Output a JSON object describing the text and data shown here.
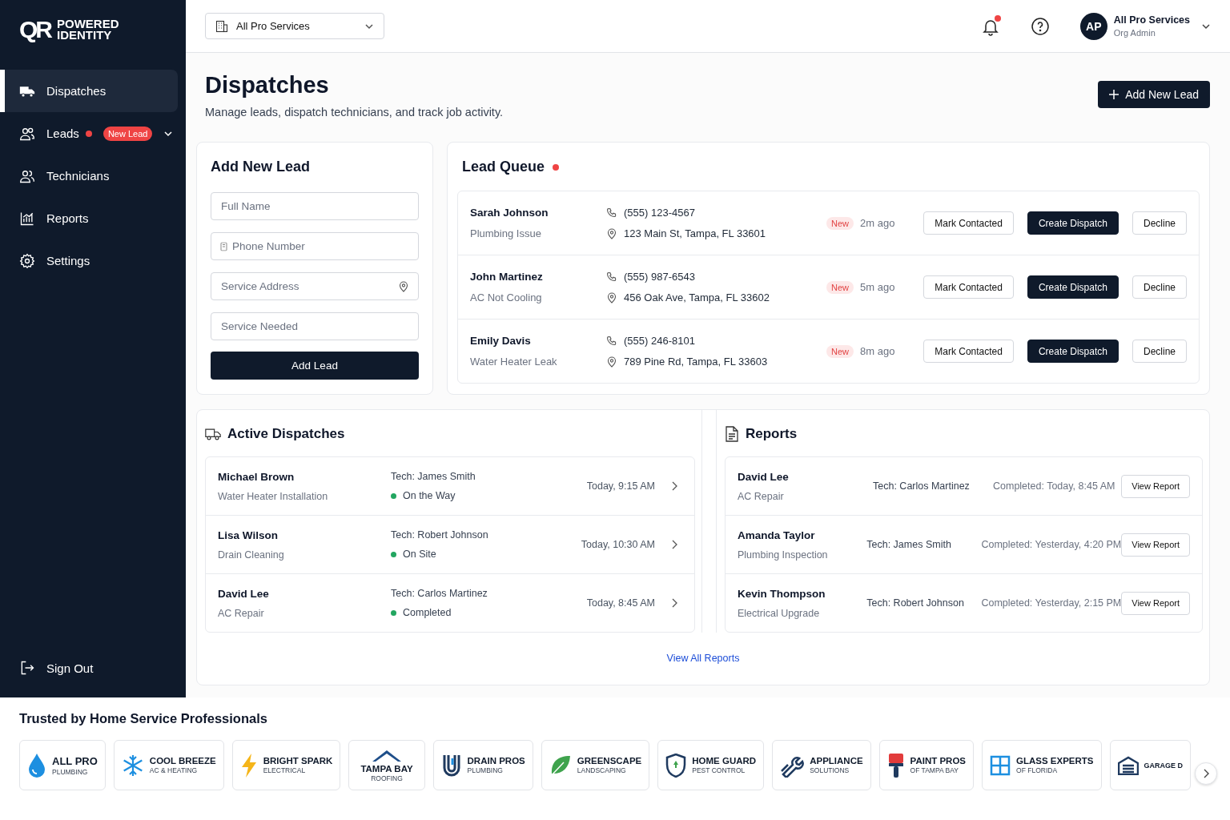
{
  "sidebar": {
    "logo": {
      "mark": "QR",
      "line_1": "POWERED",
      "line_2": "IDENTITY"
    },
    "nav": [
      {
        "label": "Dispatches",
        "selected": true
      },
      {
        "label": "Leads",
        "selected": false,
        "alert": true,
        "badge": "New Lead",
        "expanded": false
      },
      {
        "label": "Technicians",
        "selected": false
      },
      {
        "label": "Reports",
        "selected": false
      },
      {
        "label": "Settings",
        "selected": false
      }
    ],
    "sign_out": "Sign Out"
  },
  "topbar": {
    "org_select": "All Pro Services",
    "notifications": {
      "unread": true
    },
    "user": {
      "initials": "AP",
      "name": "All Pro Services",
      "role": "Org Admin"
    }
  },
  "page": {
    "title": "Dispatches",
    "subtitle": "Manage leads, dispatch technicians, and track job activity.",
    "primary_action": "Add New Lead"
  },
  "add_lead_form": {
    "title": "Add New Lead",
    "fields": [
      {
        "placeholder": "Full Name"
      },
      {
        "placeholder": "Phone Number"
      },
      {
        "placeholder": "Service Address"
      },
      {
        "placeholder": "Service Needed"
      }
    ],
    "submit": "Add Lead"
  },
  "lead_queue": {
    "title": "Lead Queue",
    "live": true,
    "leads": [
      {
        "name": "Sarah Johnson",
        "service": "Plumbing Issue",
        "phone": "(555) 123-4567",
        "address": "123 Main St, Tampa, FL 33601",
        "status": "New",
        "age": "2m ago",
        "actions": [
          {
            "label": "Mark Contacted",
            "primary": false
          },
          {
            "label": "Create Dispatch",
            "primary": true
          },
          {
            "label": "Decline",
            "primary": false
          }
        ]
      },
      {
        "name": "John Martinez",
        "service": "AC Not Cooling",
        "phone": "(555) 987-6543",
        "address": "456 Oak Ave, Tampa, FL 33602",
        "status": "New",
        "age": "5m ago",
        "actions": [
          {
            "label": "Mark Contacted",
            "primary": false
          },
          {
            "label": "Create Dispatch",
            "primary": true
          },
          {
            "label": "Decline",
            "primary": false
          }
        ]
      },
      {
        "name": "Emily Davis",
        "service": "Water Heater Leak",
        "phone": "(555) 246-8101",
        "address": "789 Pine Rd, Tampa, FL 33603",
        "status": "New",
        "age": "8m ago",
        "actions": [
          {
            "label": "Mark Contacted",
            "primary": false
          },
          {
            "label": "Create Dispatch",
            "primary": true
          },
          {
            "label": "Decline",
            "primary": false
          }
        ]
      }
    ]
  },
  "active_dispatches": {
    "title": "Active Dispatches",
    "dispatches": [
      {
        "customer": "Michael Brown",
        "service": "Water Heater Installation",
        "tech": "Tech: James Smith",
        "status": "On the Way",
        "time": "Today, 9:15 AM"
      },
      {
        "customer": "Lisa Wilson",
        "service": "Drain Cleaning",
        "tech": "Tech: Robert Johnson",
        "status": "On Site",
        "time": "Today, 10:30 AM"
      },
      {
        "customer": "David Lee",
        "service": "AC Repair",
        "tech": "Tech: Carlos Martinez",
        "status": "Completed",
        "time": "Today, 8:45 AM"
      }
    ]
  },
  "reports": {
    "title": "Reports",
    "reports": [
      {
        "customer": "David Lee",
        "service": "AC Repair",
        "tech": "Tech: Carlos Martinez",
        "completed": "Completed: Today, 8:45 AM",
        "action": "View Report"
      },
      {
        "customer": "Amanda Taylor",
        "service": "Plumbing Inspection",
        "tech": "Tech: James Smith",
        "completed": "Completed: Yesterday, 4:20 PM",
        "action": "View Report"
      },
      {
        "customer": "Kevin Thompson",
        "service": "Electrical Upgrade",
        "tech": "Tech: Robert Johnson",
        "completed": "Completed: Yesterday, 2:15 PM",
        "action": "View Report"
      }
    ],
    "view_all": "View All Reports"
  },
  "partners": {
    "title": "Trusted by Home Service Professionals",
    "logos": [
      {
        "kind": "inline",
        "name": "ALL PRO",
        "sub": "PLUMBING"
      },
      {
        "kind": "inline",
        "name": "COOL BREEZE",
        "sub": "AC & HEATING"
      },
      {
        "kind": "inline",
        "name": "BRIGHT SPARK",
        "sub": "ELECTRICAL"
      },
      {
        "kind": "stacked",
        "name": "TAMPA BAY",
        "sub": "ROOFING"
      },
      {
        "kind": "inline",
        "name": "DRAIN PROS",
        "sub": "PLUMBING"
      },
      {
        "kind": "inline",
        "name": "GREENSCAPE",
        "sub": "LANDSCAPING"
      },
      {
        "kind": "inline",
        "name": "HOME GUARD",
        "sub": "PEST CONTROL"
      },
      {
        "kind": "inline",
        "name": "APPLIANCE",
        "sub": "SOLUTIONS"
      },
      {
        "kind": "inline",
        "name": "PAINT PROS",
        "sub": "OF TAMPA BAY"
      },
      {
        "kind": "inline",
        "name": "GLASS EXPERTS",
        "sub": "OF FLORIDA"
      },
      {
        "kind": "inline",
        "name": "GARAGE D"
      }
    ]
  }
}
